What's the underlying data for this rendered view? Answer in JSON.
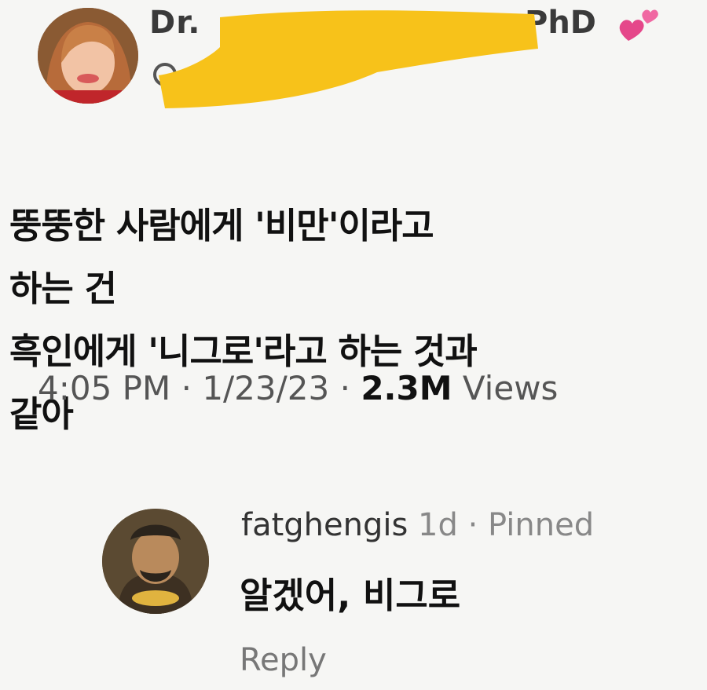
{
  "post": {
    "author_prefix": "Dr.",
    "author_suffix": "PhD",
    "heart_icon": "two-hearts-icon",
    "redaction_color": "#f7c21a",
    "text_lines": [
      "뚱뚱한 사람에게 '비만'이라고",
      "하는 건",
      "흑인에게 '니그로'라고 하는 것과",
      "같아"
    ],
    "time": "4:05 PM",
    "date": "1/23/23",
    "views_count": "2.3M",
    "views_label": "Views",
    "separator": "·"
  },
  "comment": {
    "username": "fatghengis",
    "age": "1d",
    "separator": "·",
    "pinned_label": "Pinned",
    "text": "알겠어, 비그로",
    "reply_label": "Reply"
  }
}
